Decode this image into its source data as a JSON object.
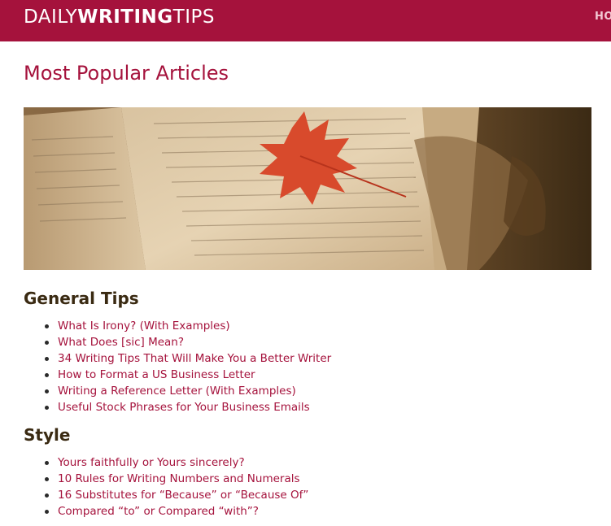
{
  "header": {
    "logo_part1": "DAILY",
    "logo_part2": "WRITING",
    "logo_part3": "TIPS",
    "nav_home": "HO",
    "brand_color": "#a5123c"
  },
  "main": {
    "title": "Most Popular Articles",
    "hero_image": "open-book-with-red-maple-leaf",
    "sections": [
      {
        "heading": "General Tips",
        "articles": [
          "What Is Irony? (With Examples)",
          "What Does [sic] Mean?",
          "34 Writing Tips That Will Make You a Better Writer",
          "How to Format a US Business Letter",
          "Writing a Reference Letter (With Examples)",
          "Useful Stock Phrases for Your Business Emails"
        ]
      },
      {
        "heading": "Style",
        "articles": [
          "Yours faithfully or Yours sincerely?",
          "10 Rules for Writing Numbers and Numerals",
          "16 Substitutes for “Because” or “Because Of”",
          "Compared “to” or Compared “with”?"
        ]
      }
    ]
  }
}
